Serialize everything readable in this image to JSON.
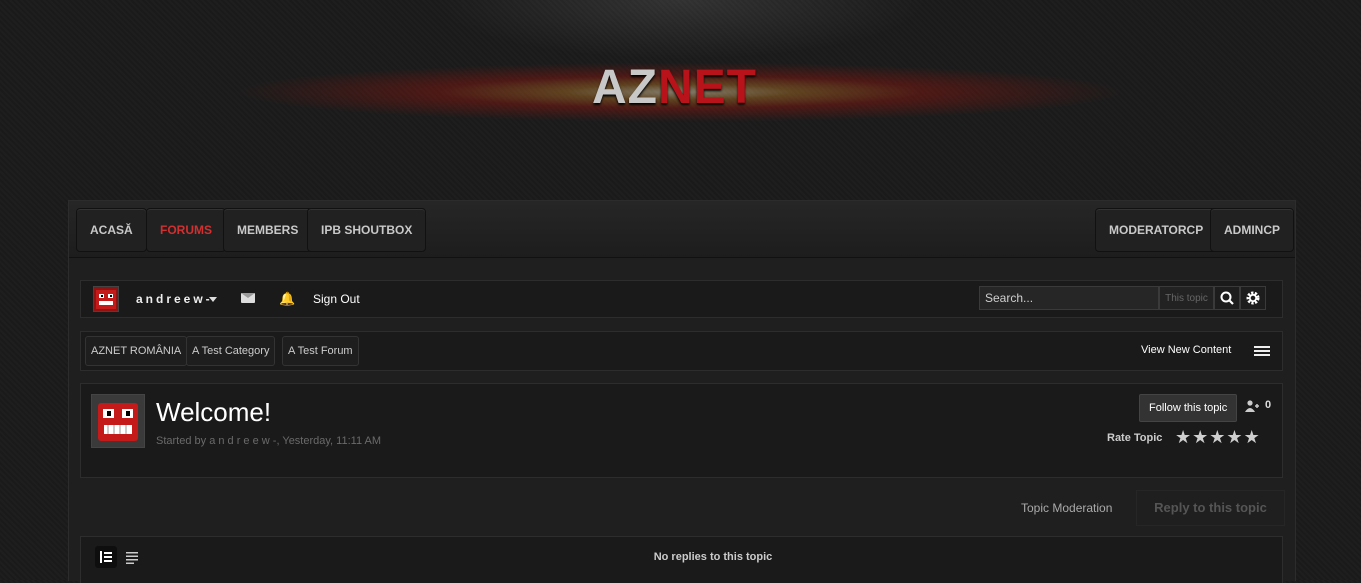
{
  "logo": {
    "part1": "AZ",
    "part2": "NET"
  },
  "nav": {
    "left": [
      "ACASĂ",
      "FORUMS",
      "MEMBERS",
      "IPB SHOUTBOX"
    ],
    "right": [
      "MODERATORCP",
      "ADMINCP"
    ],
    "active": "FORUMS",
    "active_color": "#d23030"
  },
  "userbar": {
    "username": "andreew-",
    "sign_out": "Sign Out",
    "search_placeholder": "Search...",
    "search_scope": "This topic",
    "icons": [
      "avatar",
      "chevron-down-icon",
      "envelope-icon",
      "bell-icon",
      "search-icon",
      "gear-icon"
    ]
  },
  "breadcrumb": [
    "AZNET ROMÂNIA",
    "A Test Category",
    "A Test Forum"
  ],
  "view_new_content": "View New Content",
  "topic": {
    "title": "Welcome!",
    "started_by": "Started by a n d r e e w -, Yesterday, 11:11 AM",
    "follow_label": "Follow this topic",
    "followers": "0",
    "rate_label": "Rate Topic",
    "rating_stars": 5
  },
  "actions": {
    "moderation": "Topic Moderation",
    "reply": "Reply to this topic"
  },
  "replies": {
    "message": "No replies to this topic"
  },
  "colors": {
    "accent_red": "#b8121a",
    "background": "#1b1b1b"
  }
}
